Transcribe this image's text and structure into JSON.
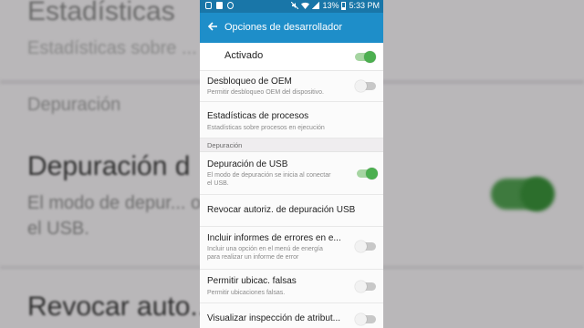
{
  "background": {
    "line1": "Estadísticas",
    "line2": "Estadísticas sobre ... ejecución",
    "line3": "Depuración",
    "line4": "Depuración d",
    "line5": "El modo de depur...         onectar",
    "line6": "el USB.",
    "line7": "Revocar auto...  ación USB"
  },
  "status_bar": {
    "battery": "13%",
    "time": "5:33 PM"
  },
  "app_bar": {
    "title": "Opciones de desarrollador"
  },
  "master_switch": {
    "label": "Activado",
    "state": "on"
  },
  "items": [
    {
      "title": "Desbloqueo de OEM",
      "subtitle": "Permitir desbloqueo OEM del dispositivo.",
      "toggle": "off"
    },
    {
      "title": "Estadísticas de procesos",
      "subtitle": "Estadísticas sobre procesos en ejecución"
    },
    {
      "section": "Depuración"
    },
    {
      "title": "Depuración de USB",
      "subtitle_1": "El modo de depuración se inicia al conectar",
      "subtitle_2": "el USB.",
      "toggle": "on"
    },
    {
      "title": "Revocar autoriz. de depuración USB"
    },
    {
      "title": "Incluir informes de errores en e...",
      "subtitle_1": "Incluir una opción en el menú de energía",
      "subtitle_2": "para realizar un informe de error",
      "toggle": "off"
    },
    {
      "title": "Permitir ubicac. falsas",
      "subtitle": "Permitir ubicaciones falsas.",
      "toggle": "off"
    },
    {
      "title": "Visualizar inspección de atribut...",
      "toggle": "off"
    }
  ],
  "colors": {
    "appbar": "#1e8ec9",
    "statusbar": "#1976a8",
    "toggle_on": "#4caf50",
    "toggle_off": "#f2f2f2"
  }
}
